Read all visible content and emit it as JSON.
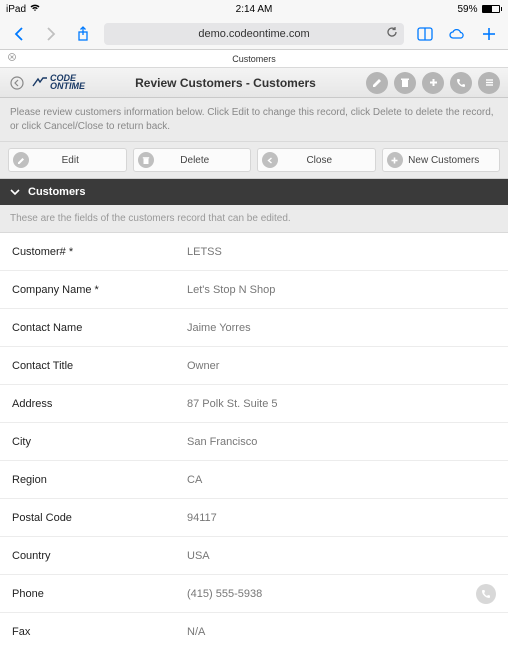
{
  "status": {
    "carrier": "iPad",
    "time": "2:14 AM",
    "battery": "59%"
  },
  "browser": {
    "url": "demo.codeontime.com",
    "tab_label": "Customers"
  },
  "header": {
    "logo_top": "CODE",
    "logo_bottom": "ONTIME",
    "title": "Review Customers - Customers"
  },
  "instructions": "Please review customers information below. Click Edit to change this record, click Delete to delete the record, or click Cancel/Close to return back.",
  "actions": {
    "edit": "Edit",
    "delete": "Delete",
    "close": "Close",
    "new": "New Customers"
  },
  "section": {
    "title": "Customers",
    "subtitle": "These are the fields of the customers record that can be edited."
  },
  "fields": [
    {
      "label": "Customer# *",
      "value": "LETSS"
    },
    {
      "label": "Company Name *",
      "value": "Let's Stop N Shop"
    },
    {
      "label": "Contact Name",
      "value": "Jaime Yorres"
    },
    {
      "label": "Contact Title",
      "value": "Owner"
    },
    {
      "label": "Address",
      "value": "87 Polk St. Suite 5"
    },
    {
      "label": "City",
      "value": "San Francisco"
    },
    {
      "label": "Region",
      "value": "CA"
    },
    {
      "label": "Postal Code",
      "value": "94117"
    },
    {
      "label": "Country",
      "value": "USA"
    },
    {
      "label": "Phone",
      "value": "(415) 555-5938",
      "callable": true
    },
    {
      "label": "Fax",
      "value": "N/A"
    }
  ]
}
